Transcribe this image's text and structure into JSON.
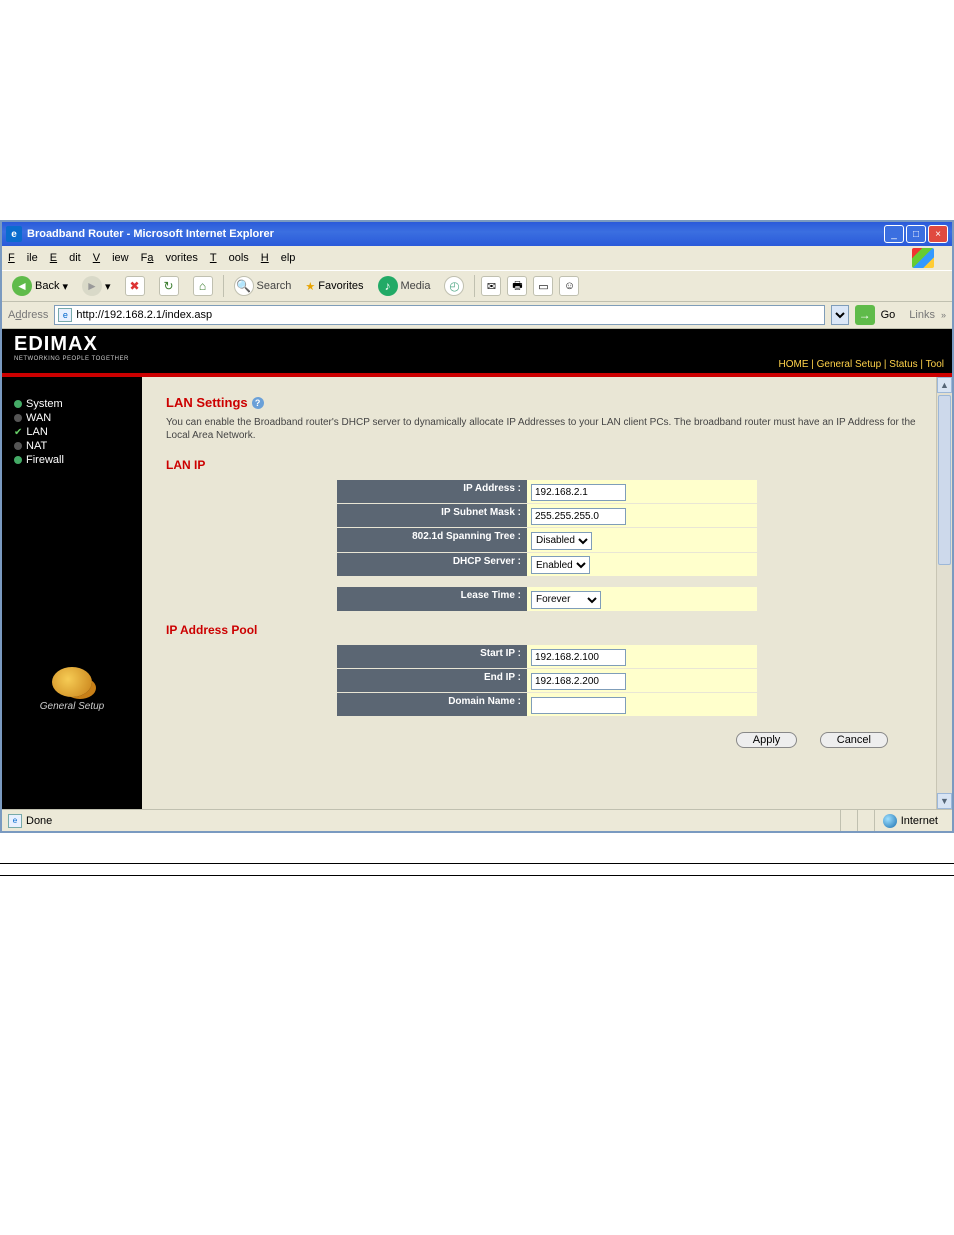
{
  "window": {
    "title": "Broadband Router - Microsoft Internet Explorer",
    "menus": {
      "file": "File",
      "edit": "Edit",
      "view": "View",
      "favorites": "Favorites",
      "tools": "Tools",
      "help": "Help"
    },
    "toolbar": {
      "back": "Back",
      "search": "Search",
      "favorites": "Favorites",
      "media": "Media"
    },
    "address_label": "Address",
    "address": "http://192.168.2.1/index.asp",
    "go": "Go",
    "links": "Links"
  },
  "brand": {
    "logo": "EDIMAX",
    "tagline": "NETWORKING PEOPLE TOGETHER"
  },
  "topnav": {
    "home": "HOME",
    "general": "General Setup",
    "status": "Status",
    "tool": "Tool"
  },
  "sidebar": {
    "items": [
      {
        "label": "System"
      },
      {
        "label": "WAN"
      },
      {
        "label": "LAN"
      },
      {
        "label": "NAT"
      },
      {
        "label": "Firewall"
      }
    ],
    "footer": "General Setup"
  },
  "page": {
    "title": "LAN Settings",
    "help_icon": "?",
    "desc": "You can enable the Broadband router's DHCP server to dynamically allocate IP Addresses to your LAN client PCs. The broadband router must have an IP Address for the Local Area Network.",
    "section1": "LAN IP",
    "section2": "IP Address Pool",
    "labels": {
      "ip_address": "IP Address :",
      "subnet": "IP Subnet Mask :",
      "spanning": "802.1d Spanning Tree :",
      "dhcp": "DHCP Server :",
      "lease": "Lease Time :",
      "start_ip": "Start IP :",
      "end_ip": "End IP :",
      "domain": "Domain Name :"
    },
    "values": {
      "ip_address": "192.168.2.1",
      "subnet": "255.255.255.0",
      "spanning": "Disabled",
      "dhcp": "Enabled",
      "lease": "Forever",
      "start_ip": "192.168.2.100",
      "end_ip": "192.168.2.200",
      "domain": ""
    },
    "buttons": {
      "apply": "Apply",
      "cancel": "Cancel"
    }
  },
  "status": {
    "done": "Done",
    "zone": "Internet"
  }
}
